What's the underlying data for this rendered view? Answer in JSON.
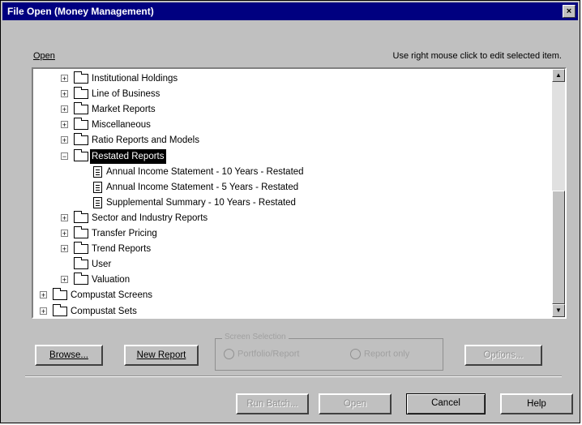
{
  "window": {
    "title": "File Open   (Money Management)",
    "close_glyph": "×"
  },
  "labels": {
    "open": "Open",
    "hint": "Use right mouse click to edit selected item."
  },
  "tree": {
    "items": [
      {
        "label": "Institutional Holdings",
        "expander": "+",
        "icon": "folder-icon"
      },
      {
        "label": "Line of Business",
        "expander": "+",
        "icon": "folder-icon"
      },
      {
        "label": "Market Reports",
        "expander": "+",
        "icon": "folder-icon"
      },
      {
        "label": "Miscellaneous",
        "expander": "+",
        "icon": "folder-icon"
      },
      {
        "label": "Ratio Reports and Models",
        "expander": "+",
        "icon": "folder-icon"
      },
      {
        "label": "Restated Reports",
        "expander": "−",
        "icon": "open-folder-icon",
        "selected": true
      },
      {
        "label": "Annual Income Statement - 10 Years - Restated",
        "icon": "document-icon"
      },
      {
        "label": "Annual Income Statement - 5 Years - Restated",
        "icon": "document-icon"
      },
      {
        "label": "Supplemental Summary - 10 Years - Restated",
        "icon": "document-icon"
      },
      {
        "label": "Sector and Industry Reports",
        "expander": "+",
        "icon": "folder-icon"
      },
      {
        "label": "Transfer Pricing",
        "expander": "+",
        "icon": "folder-icon"
      },
      {
        "label": "Trend Reports",
        "expander": "+",
        "icon": "folder-icon"
      },
      {
        "label": "User",
        "icon": "folder-icon"
      },
      {
        "label": "Valuation",
        "expander": "+",
        "icon": "folder-icon"
      },
      {
        "label": "Compustat Screens",
        "expander": "+",
        "icon": "folder-icon"
      },
      {
        "label": "Compustat Sets",
        "expander": "+",
        "icon": "folder-icon"
      }
    ]
  },
  "scrollbar": {
    "up": "▲",
    "down": "▼"
  },
  "buttons": {
    "browse": "Browse...",
    "new_report": "New Report",
    "options": "Options...",
    "run_batch": "Run Batch...",
    "open": "Open",
    "cancel": "Cancel",
    "help": "Help"
  },
  "group": {
    "legend": "Screen Selection",
    "radio1": "Portfolio/Report",
    "radio2": "Report only"
  }
}
